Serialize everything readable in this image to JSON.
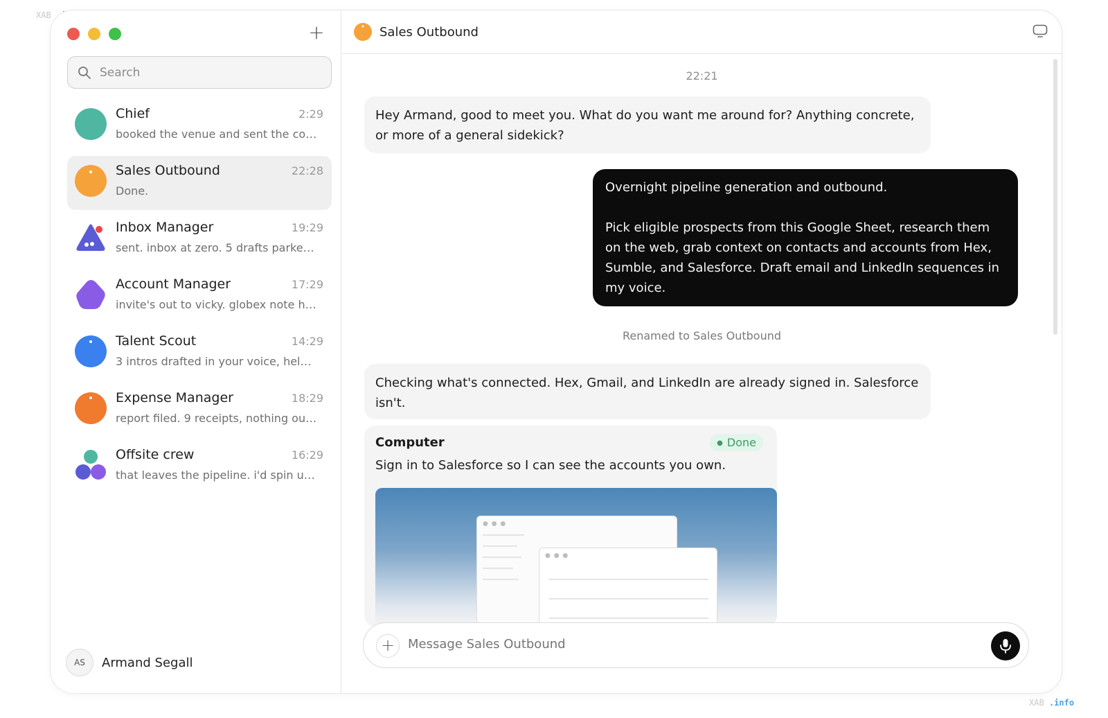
{
  "watermark": {
    "prefix": "XAB",
    "suffix": ".info"
  },
  "sidebar": {
    "search_placeholder": "Search",
    "new_chat_icon": "plus-icon",
    "chats": [
      {
        "name": "Chief",
        "time": "2:29",
        "preview": "booked the venue and sent the con...",
        "avatar_color": "#4fb6a2"
      },
      {
        "name": "Sales Outbound",
        "time": "22:28",
        "preview": "Done.",
        "avatar_color": "#f5a23a",
        "active": true
      },
      {
        "name": "Inbox Manager",
        "time": "19:29",
        "preview": "sent. inbox at zero. 5 drafts parked ...",
        "avatar_color": "#5b5bd6"
      },
      {
        "name": "Account Manager",
        "time": "17:29",
        "preview": "invite's out to vicky. globex note he...",
        "avatar_color": "#8a5ce6"
      },
      {
        "name": "Talent Scout",
        "time": "14:29",
        "preview": "3 intros drafted in your voice, held f...",
        "avatar_color": "#3a80ee"
      },
      {
        "name": "Expense Manager",
        "time": "18:29",
        "preview": "report filed. 9 receipts, nothing out...",
        "avatar_color": "#f07a2e"
      },
      {
        "name": "Offsite crew",
        "time": "16:29",
        "preview": "that leaves the pipeline. i'd spin up ...",
        "avatar_color": "#8a5ce6"
      }
    ],
    "user": {
      "initials": "AS",
      "name": "Armand Segall"
    }
  },
  "main": {
    "title": "Sales Outbound",
    "timestamp": "22:21",
    "msg1": "Hey Armand, good to meet you. What do you want me around for? Anything concrete, or more of a general sidekick?",
    "user_msg_p1": "Overnight pipeline generation and outbound.",
    "user_msg_p2": "Pick eligible prospects from this Google Sheet, research them on the web, grab context on contacts and accounts from Hex, Sumble, and Salesforce. Draft email and LinkedIn sequences in my voice.",
    "renamed": "Renamed to Sales Outbound",
    "msg2": "Checking what's connected. Hex, Gmail, and LinkedIn are already signed in. Salesforce isn't.",
    "card": {
      "title": "Computer",
      "status": "Done",
      "text": "Sign in to Salesforce so I can see the accounts you own."
    },
    "composer_placeholder": "Message Sales Outbound"
  }
}
